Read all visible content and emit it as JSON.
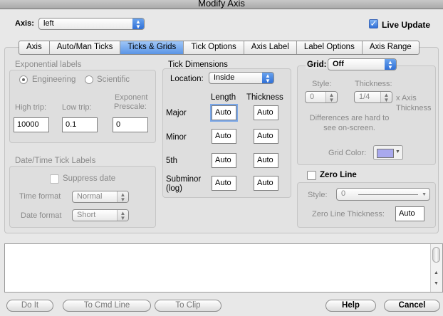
{
  "window": {
    "title": "Modify Axis"
  },
  "axis_select": {
    "label": "Axis:",
    "value": "left"
  },
  "live_update": {
    "label": "Live Update",
    "checked": true
  },
  "tabs": [
    {
      "label": "Axis"
    },
    {
      "label": "Auto/Man Ticks"
    },
    {
      "label": "Ticks & Grids",
      "active": true
    },
    {
      "label": "Tick Options"
    },
    {
      "label": "Axis Label"
    },
    {
      "label": "Label Options"
    },
    {
      "label": "Axis Range"
    }
  ],
  "exponential": {
    "title": "Exponential labels",
    "engineering": "Engineering",
    "scientific": "Scientific",
    "high_trip_label": "High trip:",
    "high_trip_value": "10000",
    "low_trip_label": "Low trip:",
    "low_trip_value": "0.1",
    "exponent_label_1": "Exponent",
    "exponent_label_2": "Prescale:",
    "exponent_value": "0"
  },
  "datetime": {
    "title": "Date/Time Tick Labels",
    "suppress_label": "Suppress date",
    "time_format_label": "Time format",
    "time_format_value": "Normal",
    "date_format_label": "Date format",
    "date_format_value": "Short"
  },
  "tick_dimensions": {
    "title": "Tick Dimensions",
    "location_label": "Location:",
    "location_value": "Inside",
    "length_header": "Length",
    "thickness_header": "Thickness",
    "major_label": "Major",
    "minor_label": "Minor",
    "fifth_label": "5th",
    "subminor_label_1": "Subminor",
    "subminor_label_2": "(log)",
    "auto": "Auto"
  },
  "grid": {
    "label": "Grid:",
    "value": "Off",
    "style_label": "Style:",
    "style_value": "0",
    "thickness_label": "Thickness:",
    "thickness_value": "1/4",
    "x_axis_1": "x Axis",
    "x_axis_2": "Thickness",
    "note_1": "Differences are hard to",
    "note_2": "see on-screen.",
    "color_label": "Grid Color:",
    "color": "#a9a9ee"
  },
  "zero_line": {
    "label": "Zero Line",
    "style_label": "Style:",
    "style_value": "0",
    "thickness_label": "Zero Line Thickness:",
    "thickness_value": "Auto"
  },
  "buttons": {
    "do_it": "Do It",
    "to_cmd_line": "To Cmd Line",
    "to_clip": "To Clip",
    "help": "Help",
    "cancel": "Cancel"
  }
}
